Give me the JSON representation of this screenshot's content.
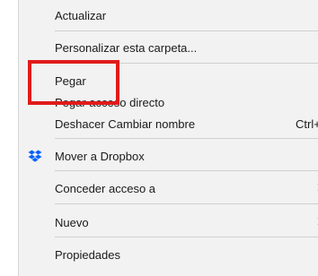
{
  "context_menu": {
    "items": [
      {
        "label": "Actualizar"
      },
      {
        "label": "Personalizar esta carpeta..."
      },
      {
        "label": "Pegar"
      },
      {
        "label": "Pegar acceso directo"
      },
      {
        "label": "Deshacer Cambiar nombre",
        "shortcut": "Ctrl+Z"
      },
      {
        "label": "Mover a Dropbox",
        "icon": "dropbox-icon"
      },
      {
        "label": "Conceder acceso a",
        "submenu": true
      },
      {
        "label": "Nuevo",
        "submenu": true
      },
      {
        "label": "Propiedades"
      }
    ]
  },
  "colors": {
    "menu_background": "#f2f2f2",
    "highlight_border": "#e01b1b",
    "dropbox_blue": "#0061fe"
  }
}
